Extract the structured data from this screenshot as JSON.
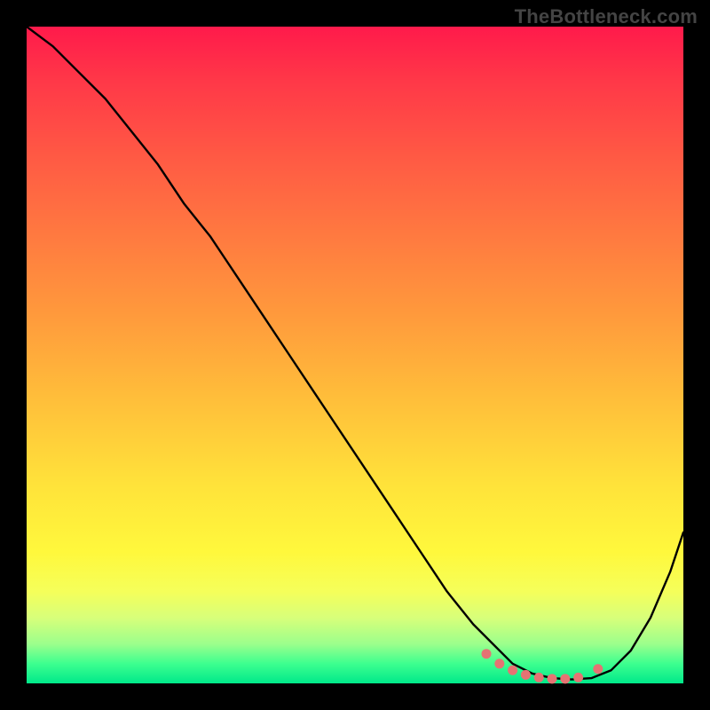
{
  "watermark": "TheBottleneck.com",
  "colors": {
    "curve_stroke": "#000000",
    "marker_fill": "#e57373",
    "frame_bg": "#000000"
  },
  "chart_data": {
    "type": "line",
    "title": "",
    "xlabel": "",
    "ylabel": "",
    "xlim": [
      0,
      100
    ],
    "ylim": [
      0,
      100
    ],
    "grid": false,
    "legend": false,
    "series": [
      {
        "name": "bottleneck-curve",
        "x": [
          0,
          4,
          8,
          12,
          16,
          20,
          24,
          28,
          32,
          36,
          40,
          44,
          48,
          52,
          56,
          60,
          64,
          68,
          71,
          74,
          77,
          80,
          83,
          86,
          89,
          92,
          95,
          98,
          100
        ],
        "y": [
          100,
          97,
          93,
          89,
          84,
          79,
          73,
          68,
          62,
          56,
          50,
          44,
          38,
          32,
          26,
          20,
          14,
          9,
          6,
          3,
          1.5,
          0.8,
          0.6,
          0.8,
          2,
          5,
          10,
          17,
          23
        ]
      }
    ],
    "markers": {
      "name": "highlight-dots",
      "x": [
        70,
        72,
        74,
        76,
        78,
        80,
        82,
        84,
        87
      ],
      "y": [
        4.5,
        3.0,
        2.0,
        1.3,
        0.9,
        0.7,
        0.7,
        0.9,
        2.2
      ]
    }
  }
}
